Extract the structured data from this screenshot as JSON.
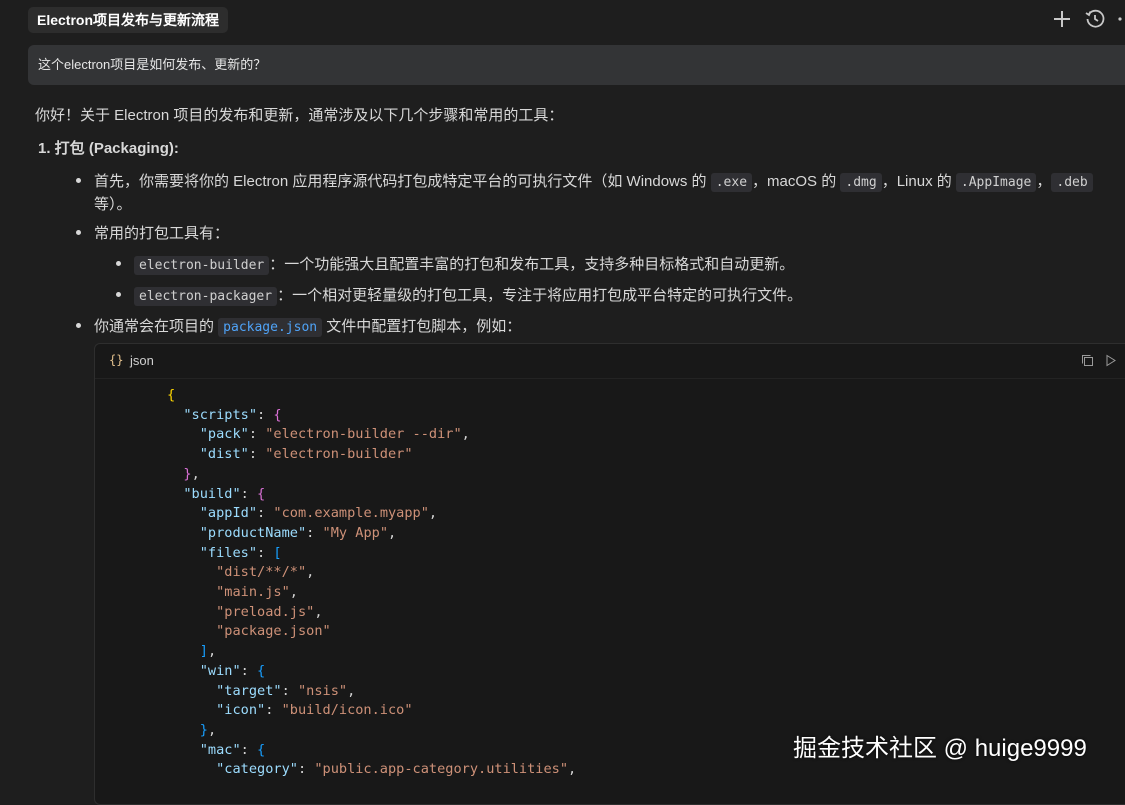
{
  "tab": {
    "title": "Electron项目发布与更新流程"
  },
  "toolbar": {
    "new_icon": "plus-icon",
    "history_icon": "history-icon",
    "more_icon": "more-icon"
  },
  "user_message": "这个electron项目是如何发布、更新的？",
  "intro": "你好！关于 Electron 项目的发布和更新，通常涉及以下几个步骤和常用的工具：",
  "section1": {
    "heading": "1. 打包 (Packaging):",
    "bullet1": {
      "text_a": "首先，你需要将你的 Electron 应用程序源代码打包成特定平台的可执行文件（如 Windows 的 ",
      "code_a": ".exe",
      "text_b": "，macOS 的 ",
      "code_b": ".dmg",
      "text_c": "，Linux 的 ",
      "code_c": ".AppImage",
      "text_d": "，",
      "code_d": ".deb",
      "line2": "等）。"
    },
    "bullet2": "常用的打包工具有：",
    "sub1": {
      "code": "electron-builder",
      "text": "：一个功能强大且配置丰富的打包和发布工具，支持多种目标格式和自动更新。"
    },
    "sub2": {
      "code": "electron-packager",
      "text": "：一个相对更轻量级的打包工具，专注于将应用打包成平台特定的可执行文件。"
    },
    "bullet3": {
      "text_a": "你通常会在项目的 ",
      "code": "package.json",
      "text_b": " 文件中配置打包脚本，例如："
    }
  },
  "code_block": {
    "language": "json",
    "lang_icon": "braces-icon",
    "copy_icon": "copy-icon",
    "run_icon": "play-icon",
    "tokens": {
      "open": "{",
      "scripts_key": "\"scripts\"",
      "pack_key": "\"pack\"",
      "pack_val": "\"electron-builder --dir\"",
      "dist_key": "\"dist\"",
      "dist_val": "\"electron-builder\"",
      "build_key": "\"build\"",
      "appid_key": "\"appId\"",
      "appid_val": "\"com.example.myapp\"",
      "pname_key": "\"productName\"",
      "pname_val": "\"My App\"",
      "files_key": "\"files\"",
      "f1": "\"dist/**/*\"",
      "f2": "\"main.js\"",
      "f3": "\"preload.js\"",
      "f4": "\"package.json\"",
      "win_key": "\"win\"",
      "target_key": "\"target\"",
      "target_val": "\"nsis\"",
      "icon_key": "\"icon\"",
      "icon_val": "\"build/icon.ico\"",
      "mac_key": "\"mac\"",
      "category_key": "\"category\"",
      "category_val": "\"public.app-category.utilities\""
    }
  },
  "watermark": "掘金技术社区 @ huige9999",
  "colors": {
    "background": "#1e1e1e",
    "code_key": "#9cdcfe",
    "code_string": "#ce9178",
    "inline_code_blue": "#4fa3f7"
  }
}
